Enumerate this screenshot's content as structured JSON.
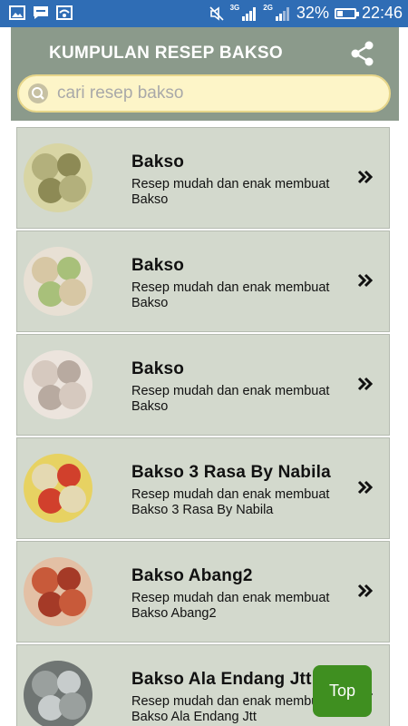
{
  "status_bar": {
    "net1": "3G",
    "net2": "2G",
    "battery_percent": "32%",
    "battery_level": 0.32,
    "time": "22:46"
  },
  "header": {
    "title": "KUMPULAN RESEP BAKSO",
    "share_icon": "share-icon"
  },
  "search": {
    "placeholder": "cari resep bakso",
    "value": ""
  },
  "list": {
    "items": [
      {
        "title": "Bakso",
        "desc": "Resep mudah dan enak membuat Bakso",
        "thumb_colors": [
          "#b3b07c",
          "#8d8a55",
          "#d8d5a4"
        ]
      },
      {
        "title": "Bakso",
        "desc": "Resep mudah dan enak membuat Bakso",
        "thumb_colors": [
          "#d7c7a4",
          "#a8c07a",
          "#e8e0d4"
        ]
      },
      {
        "title": "Bakso",
        "desc": "Resep mudah dan enak membuat Bakso",
        "thumb_colors": [
          "#d6c9bf",
          "#b8aaa0",
          "#ece4dd"
        ]
      },
      {
        "title": "Bakso 3 Rasa By Nabila",
        "desc": "Resep mudah dan enak membuat Bakso 3 Rasa By Nabila",
        "thumb_colors": [
          "#e4d9b2",
          "#d1402c",
          "#e7d262"
        ]
      },
      {
        "title": "Bakso Abang2",
        "desc": "Resep mudah dan enak membuat Bakso Abang2",
        "thumb_colors": [
          "#c85a3a",
          "#a53a27",
          "#e3c0a5"
        ]
      },
      {
        "title": "Bakso Ala Endang Jtt",
        "desc": "Resep mudah dan enak membuat Bakso Ala Endang Jtt",
        "thumb_colors": [
          "#9aa09e",
          "#c7cccc",
          "#6f7573"
        ]
      }
    ]
  },
  "top_button": {
    "label": "Top"
  },
  "colors": {
    "status_bar": "#2f6db5",
    "header": "#8b9a8b",
    "search_bg": "#fdf5c8",
    "item_bg": "#d3d9cd",
    "top_button": "#3f8f20"
  }
}
